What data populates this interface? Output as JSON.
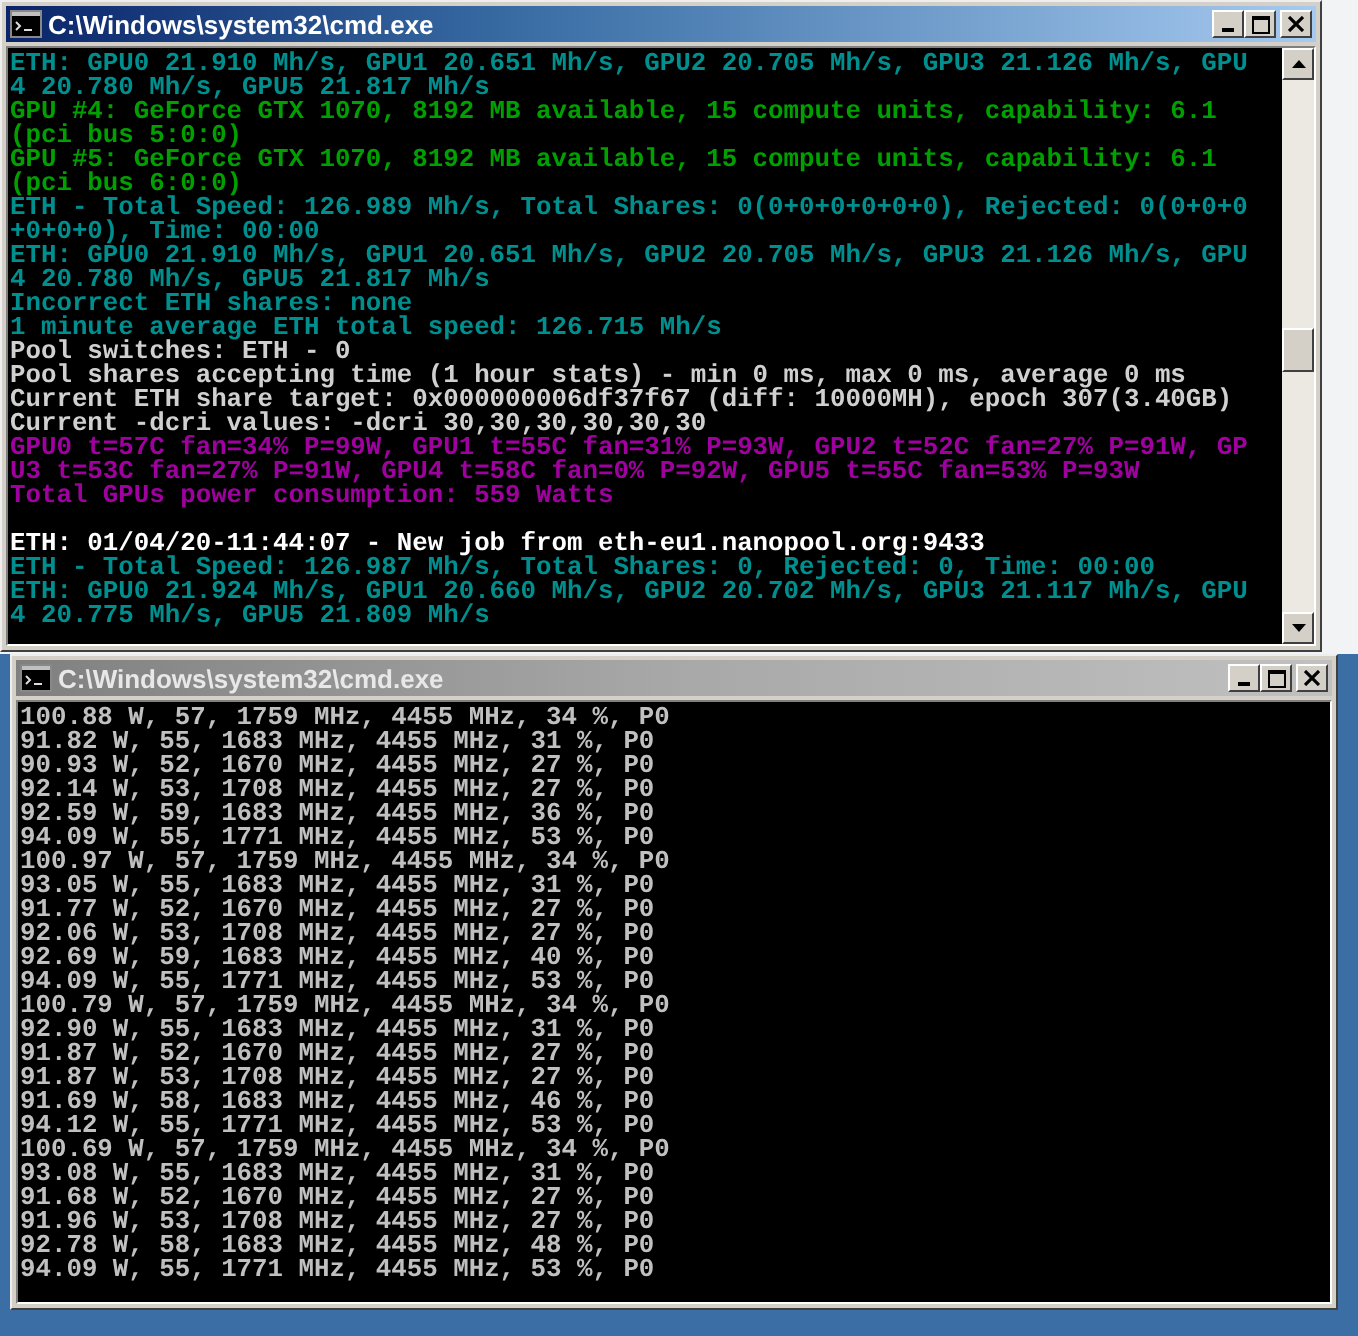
{
  "windows": [
    {
      "title": "C:\\Windows\\system32\\cmd.exe",
      "active": true,
      "lines": [
        {
          "text": "ETH: GPU0 21.910 Mh/s, GPU1 20.651 Mh/s, GPU2 20.705 Mh/s, GPU3 21.126 Mh/s, GPU",
          "kind": "speed"
        },
        {
          "text": "4 20.780 Mh/s, GPU5 21.817 Mh/s",
          "kind": "speed"
        },
        {
          "text": "GPU #4: GeForce GTX 1070, 8192 MB available, 15 compute units, capability: 6.1",
          "kind": "device"
        },
        {
          "text": "(pci bus 5:0:0)",
          "kind": "device"
        },
        {
          "text": "GPU #5: GeForce GTX 1070, 8192 MB available, 15 compute units, capability: 6.1",
          "kind": "device"
        },
        {
          "text": "(pci bus 6:0:0)",
          "kind": "device"
        },
        {
          "text": "ETH - Total Speed: 126.989 Mh/s, Total Shares: 0(0+0+0+0+0+0), Rejected: 0(0+0+0",
          "kind": "speed"
        },
        {
          "text": "+0+0+0), Time: 00:00",
          "kind": "speed"
        },
        {
          "text": "ETH: GPU0 21.910 Mh/s, GPU1 20.651 Mh/s, GPU2 20.705 Mh/s, GPU3 21.126 Mh/s, GPU",
          "kind": "speed"
        },
        {
          "text": "4 20.780 Mh/s, GPU5 21.817 Mh/s",
          "kind": "speed"
        },
        {
          "text": "Incorrect ETH shares: none",
          "kind": "speed"
        },
        {
          "text": "1 minute average ETH total speed: 126.715 Mh/s",
          "kind": "speed"
        },
        {
          "text": "Pool switches: ETH - 0",
          "kind": "pool"
        },
        {
          "text": "Pool shares accepting time (1 hour stats) - min 0 ms, max 0 ms, average 0 ms",
          "kind": "pool"
        },
        {
          "text": "Current ETH share target: 0x000000006df37f67 (diff: 10000MH), epoch 307(3.40GB)",
          "kind": "pool"
        },
        {
          "text": "Current -dcri values: -dcri 30,30,30,30,30,30",
          "kind": "pool"
        },
        {
          "text": "GPU0 t=57C fan=34% P=99W, GPU1 t=55C fan=31% P=93W, GPU2 t=52C fan=27% P=91W, GP",
          "kind": "temperature"
        },
        {
          "text": "U3 t=53C fan=27% P=91W, GPU4 t=58C fan=0% P=92W, GPU5 t=55C fan=53% P=93W",
          "kind": "temperature"
        },
        {
          "text": "Total GPUs power consumption: 559 Watts",
          "kind": "temperature"
        },
        {
          "text": "ETH: 01/04/20-11:44:07 - New job from eth-eu1.nanopool.org:9433",
          "kind": "job",
          "gap_before": true
        },
        {
          "text": "ETH - Total Speed: 126.987 Mh/s, Total Shares: 0, Rejected: 0, Time: 00:00",
          "kind": "speed"
        },
        {
          "text": "ETH: GPU0 21.924 Mh/s, GPU1 20.660 Mh/s, GPU2 20.702 Mh/s, GPU3 21.117 Mh/s, GPU",
          "kind": "speed"
        },
        {
          "text": "4 20.775 Mh/s, GPU5 21.809 Mh/s",
          "kind": "speed"
        }
      ]
    },
    {
      "title": "C:\\Windows\\system32\\cmd.exe",
      "active": false,
      "lines": [
        {
          "text": "100.88 W, 57, 1759 MHz, 4455 MHz, 34 %, P0"
        },
        {
          "text": "91.82 W, 55, 1683 MHz, 4455 MHz, 31 %, P0"
        },
        {
          "text": "90.93 W, 52, 1670 MHz, 4455 MHz, 27 %, P0"
        },
        {
          "text": "92.14 W, 53, 1708 MHz, 4455 MHz, 27 %, P0"
        },
        {
          "text": "92.59 W, 59, 1683 MHz, 4455 MHz, 36 %, P0"
        },
        {
          "text": "94.09 W, 55, 1771 MHz, 4455 MHz, 53 %, P0"
        },
        {
          "text": "100.97 W, 57, 1759 MHz, 4455 MHz, 34 %, P0"
        },
        {
          "text": "93.05 W, 55, 1683 MHz, 4455 MHz, 31 %, P0"
        },
        {
          "text": "91.77 W, 52, 1670 MHz, 4455 MHz, 27 %, P0"
        },
        {
          "text": "92.06 W, 53, 1708 MHz, 4455 MHz, 27 %, P0"
        },
        {
          "text": "92.69 W, 59, 1683 MHz, 4455 MHz, 40 %, P0"
        },
        {
          "text": "94.09 W, 55, 1771 MHz, 4455 MHz, 53 %, P0"
        },
        {
          "text": "100.79 W, 57, 1759 MHz, 4455 MHz, 34 %, P0"
        },
        {
          "text": "92.90 W, 55, 1683 MHz, 4455 MHz, 31 %, P0"
        },
        {
          "text": "91.87 W, 52, 1670 MHz, 4455 MHz, 27 %, P0"
        },
        {
          "text": "91.87 W, 53, 1708 MHz, 4455 MHz, 27 %, P0"
        },
        {
          "text": "91.69 W, 58, 1683 MHz, 4455 MHz, 46 %, P0"
        },
        {
          "text": "94.12 W, 55, 1771 MHz, 4455 MHz, 53 %, P0"
        },
        {
          "text": "100.69 W, 57, 1759 MHz, 4455 MHz, 34 %, P0"
        },
        {
          "text": "93.08 W, 55, 1683 MHz, 4455 MHz, 31 %, P0"
        },
        {
          "text": "91.68 W, 52, 1670 MHz, 4455 MHz, 27 %, P0"
        },
        {
          "text": "91.96 W, 53, 1708 MHz, 4455 MHz, 27 %, P0"
        },
        {
          "text": "92.78 W, 58, 1683 MHz, 4455 MHz, 48 %, P0"
        },
        {
          "text": "94.09 W, 55, 1771 MHz, 4455 MHz, 53 %, P0"
        }
      ]
    }
  ]
}
